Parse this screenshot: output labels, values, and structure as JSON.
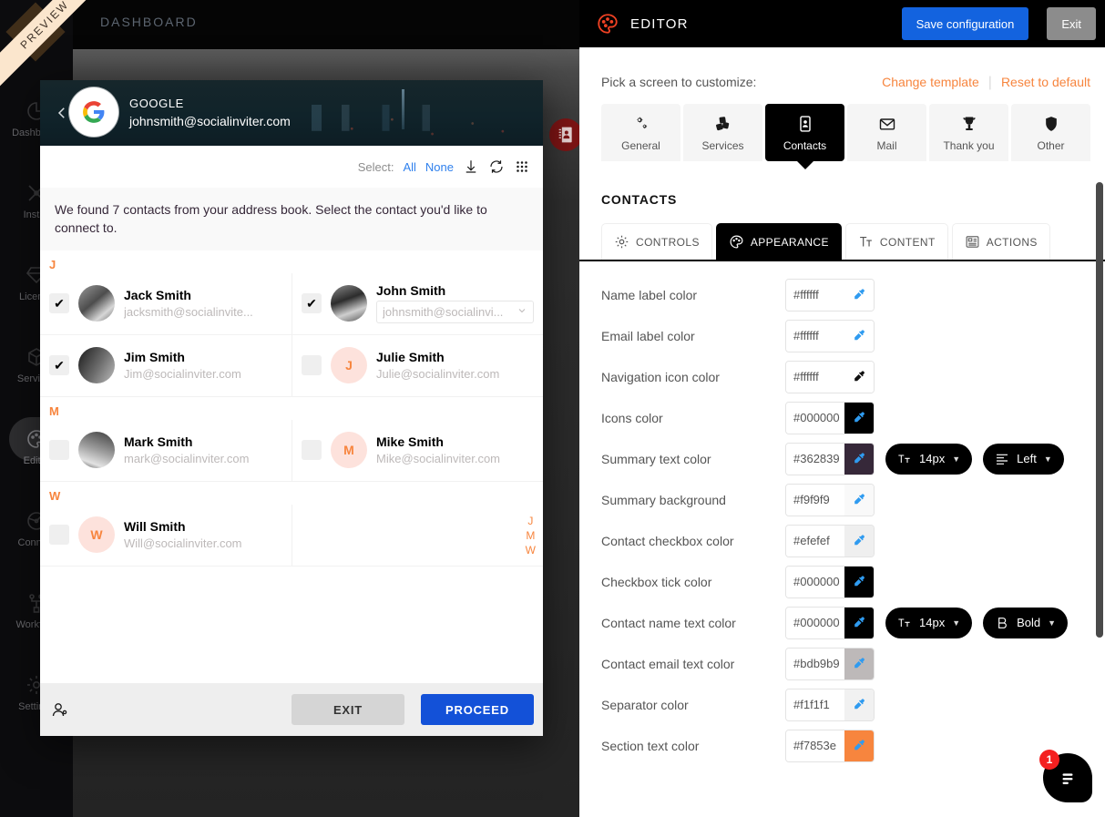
{
  "preview": {
    "ribbon_label": "PREVIEW",
    "dashboard_title": "DASHBOARD",
    "sidebar": {
      "items": [
        {
          "label": "Dashboard",
          "icon": "chart-pie-icon"
        },
        {
          "label": "Install",
          "icon": "tools-icon"
        },
        {
          "label": "License",
          "icon": "diamond-icon"
        },
        {
          "label": "Services",
          "icon": "cube-icon"
        },
        {
          "label": "Editor",
          "icon": "palette-icon"
        },
        {
          "label": "Connect",
          "icon": "antenna-icon"
        },
        {
          "label": "Workflow",
          "icon": "workflow-icon"
        },
        {
          "label": "Settings",
          "icon": "gear-icon"
        }
      ],
      "active_index": 4
    },
    "badge_icon": "contacts-book-icon"
  },
  "dialog": {
    "back_icon": "chevron-left-icon",
    "provider": "GOOGLE",
    "account_email": "johnsmith@socialinviter.com",
    "provider_icon": "google-logo-icon",
    "toolbar": {
      "select_label": "Select:",
      "all_label": "All",
      "none_label": "None",
      "icons": [
        "download-icon",
        "refresh-icon",
        "grid-icon"
      ]
    },
    "summary": "We found 7 contacts from your address book. Select the contact you'd like to connect to.",
    "alpha_index": [
      "J",
      "M",
      "W"
    ],
    "sections": [
      {
        "letter": "J",
        "rows": [
          [
            {
              "name": "Jack Smith",
              "email": "jacksmith@socialinvite...",
              "checked": true,
              "avatar_type": "photo",
              "avatar_style": "photo-a",
              "initial": "J",
              "has_select": false
            },
            {
              "name": "John Smith",
              "email": "johnsmith@socialinvi...",
              "checked": true,
              "avatar_type": "photo",
              "avatar_style": "photo-b",
              "initial": "J",
              "has_select": true
            }
          ],
          [
            {
              "name": "Jim Smith",
              "email": "Jim@socialinviter.com",
              "checked": true,
              "avatar_type": "photo",
              "avatar_style": "photo-c",
              "initial": "J",
              "has_select": false
            },
            {
              "name": "Julie Smith",
              "email": "Julie@socialinviter.com",
              "checked": false,
              "avatar_type": "letter",
              "avatar_style": "letter",
              "initial": "J",
              "has_select": false
            }
          ]
        ]
      },
      {
        "letter": "M",
        "rows": [
          [
            {
              "name": "Mark Smith",
              "email": "mark@socialinviter.com",
              "checked": false,
              "avatar_type": "photo",
              "avatar_style": "photo-d",
              "initial": "M",
              "has_select": false
            },
            {
              "name": "Mike Smith",
              "email": "Mike@socialinviter.com",
              "checked": false,
              "avatar_type": "letter",
              "avatar_style": "letter",
              "initial": "M",
              "has_select": false
            }
          ]
        ]
      },
      {
        "letter": "W",
        "rows": [
          [
            {
              "name": "Will Smith",
              "email": "Will@socialinviter.com",
              "checked": false,
              "avatar_type": "letter",
              "avatar_style": "letter",
              "initial": "W",
              "has_select": false
            },
            {
              "empty": true
            }
          ]
        ]
      }
    ],
    "footer": {
      "icon": "contact-person-icon",
      "exit_label": "EXIT",
      "proceed_label": "PROCEED"
    }
  },
  "editor": {
    "logo_icon": "palette-logo-icon",
    "title": "EDITOR",
    "save_label": "Save configuration",
    "exit_label": "Exit",
    "pick_label": "Pick a screen to customize:",
    "change_template_label": "Change template",
    "reset_label": "Reset to default",
    "screen_tabs": [
      {
        "label": "General",
        "icon": "gears-icon",
        "active": false
      },
      {
        "label": "Services",
        "icon": "blocks-icon",
        "active": false
      },
      {
        "label": "Contacts",
        "icon": "contact-card-icon",
        "active": true
      },
      {
        "label": "Mail",
        "icon": "envelope-icon",
        "active": false
      },
      {
        "label": "Thank you",
        "icon": "trophy-icon",
        "active": false
      },
      {
        "label": "Other",
        "icon": "shield-icon",
        "active": false
      }
    ],
    "section_title": "CONTACTS",
    "panel_tabs": [
      {
        "label": "CONTROLS",
        "icon": "gear-icon",
        "active": false
      },
      {
        "label": "APPEARANCE",
        "icon": "palette-icon",
        "active": true
      },
      {
        "label": "CONTENT",
        "icon": "text-icon",
        "active": false
      },
      {
        "label": "ACTIONS",
        "icon": "list-card-icon",
        "active": false
      }
    ],
    "fields": [
      {
        "label": "Name label color",
        "value": "#ffffff",
        "swatch": "#ffffff",
        "extras": []
      },
      {
        "label": "Email label color",
        "value": "#ffffff",
        "swatch": "#ffffff",
        "extras": []
      },
      {
        "label": "Navigation icon color",
        "value": "#ffffff",
        "swatch": "#ffffff",
        "extras": []
      },
      {
        "label": "Icons color",
        "value": "#000000",
        "swatch": "#000000",
        "extras": []
      },
      {
        "label": "Summary text color",
        "value": "#362839",
        "swatch": "#362839",
        "extras": [
          {
            "icon": "font-size-icon",
            "label": "14px"
          },
          {
            "icon": "align-left-icon",
            "label": "Left"
          }
        ]
      },
      {
        "label": "Summary background",
        "value": "#f9f9f9",
        "swatch": "#f9f9f9",
        "extras": []
      },
      {
        "label": "Contact checkbox color",
        "value": "#efefef",
        "swatch": "#efefef",
        "extras": []
      },
      {
        "label": "Checkbox tick color",
        "value": "#000000",
        "swatch": "#000000",
        "extras": []
      },
      {
        "label": "Contact name text color",
        "value": "#000000",
        "swatch": "#000000",
        "extras": [
          {
            "icon": "font-size-icon",
            "label": "14px"
          },
          {
            "icon": "bold-icon",
            "label": "Bold"
          }
        ]
      },
      {
        "label": "Contact email text color",
        "value": "#bdb9b9",
        "swatch": "#bdb9b9",
        "extras": []
      },
      {
        "label": "Separator color",
        "value": "#f1f1f1",
        "swatch": "#f1f1f1",
        "extras": []
      },
      {
        "label": "Section text color",
        "value": "#f7853e",
        "swatch": "#f7853e",
        "extras": []
      }
    ],
    "chat": {
      "badge_count": "1",
      "icon": "chat-bubble-icon"
    },
    "accent_orange": "#f7853e",
    "accent_blue": "#1363df"
  }
}
